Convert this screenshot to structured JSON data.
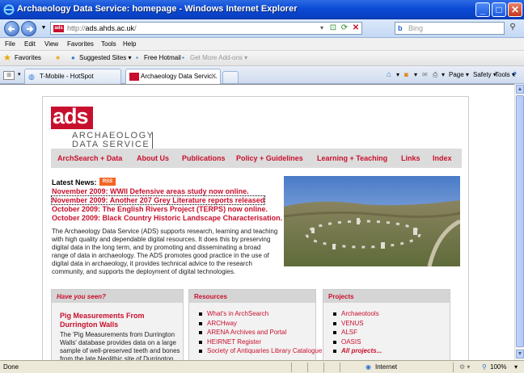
{
  "window": {
    "title": "Archaeology Data Service: homepage - Windows Internet Explorer",
    "buttons": {
      "minimize": "_",
      "maximize": "□",
      "close": "✕"
    }
  },
  "address_bar": {
    "url_prefix": "http://",
    "url_host": "ads.ahds.ac.uk",
    "url_suffix": "/",
    "favicon_label": "ads",
    "search_placeholder": "Bing"
  },
  "menu": [
    "File",
    "Edit",
    "View",
    "Favorites",
    "Tools",
    "Help"
  ],
  "favorites_bar": {
    "favorites_label": "Favorites",
    "items": [
      "Suggested Sites ▾",
      "Free Hotmail",
      "Get More Add-ons ▾"
    ]
  },
  "tabs": {
    "items": [
      "T-Mobile - HotSpot",
      "Archaeology Data Servic..."
    ],
    "close": "✕"
  },
  "command_bar": [
    "Page ▾",
    "Safety ▾",
    "Tools ▾"
  ],
  "page": {
    "logo_mark": "ads",
    "logo_text_line1": "ARCHAEOLOGY",
    "logo_text_line2": "DATA SERVICE",
    "nav": [
      "ArchSearch + Data",
      "About Us",
      "Publications",
      "Policy + Guidelines",
      "Learning + Teaching",
      "Links",
      "Index"
    ],
    "news_heading": "Latest News:",
    "rss_label": "RSS",
    "news": [
      "November 2009: WWII Defensive areas study now online.",
      "November 2009: Another 207 Grey Literature reports released",
      "October 2009: The English Rivers Project (TERPS) now online.",
      "October 2009: Black Country Historic Landscape Characterisation."
    ],
    "intro": "The Archaeology Data Service (ADS) supports research, learning and teaching with high quality and dependable digital resources. It does this by preserving digital data in the long term, and by promoting and disseminating a broad range of data in archaeology. The ADS promotes good practice in the use of digital data in archaeology, it provides technical advice to the research community, and supports the deployment of digital technologies.",
    "have_you_seen": {
      "heading": "Have you seen?",
      "title": "Pig Measurements From Durrington Walls",
      "body": "The 'Pig Measurements from Durrington Walls' database provides data on a large sample of well-preserved teeth and bones from the late Neolithic site of Durrington"
    },
    "resources": {
      "heading": "Resources",
      "items": [
        "What's in ArchSearch",
        "ARCHway",
        "ARENA Archives and Portal",
        "HEIRNET Register",
        "Society of Antiquaries Library Catalogue"
      ]
    },
    "projects": {
      "heading": "Projects",
      "items": [
        "Archaeotools",
        "VENUS",
        "ALSF",
        "OASIS",
        "All projects..."
      ]
    }
  },
  "status_bar": {
    "left": "Done",
    "zone": "Internet",
    "zoom": "100%"
  },
  "colors": {
    "brand_red": "#c8102e",
    "nav_grey": "#dcdcdc",
    "ie_blue": "#0b4ad6"
  }
}
